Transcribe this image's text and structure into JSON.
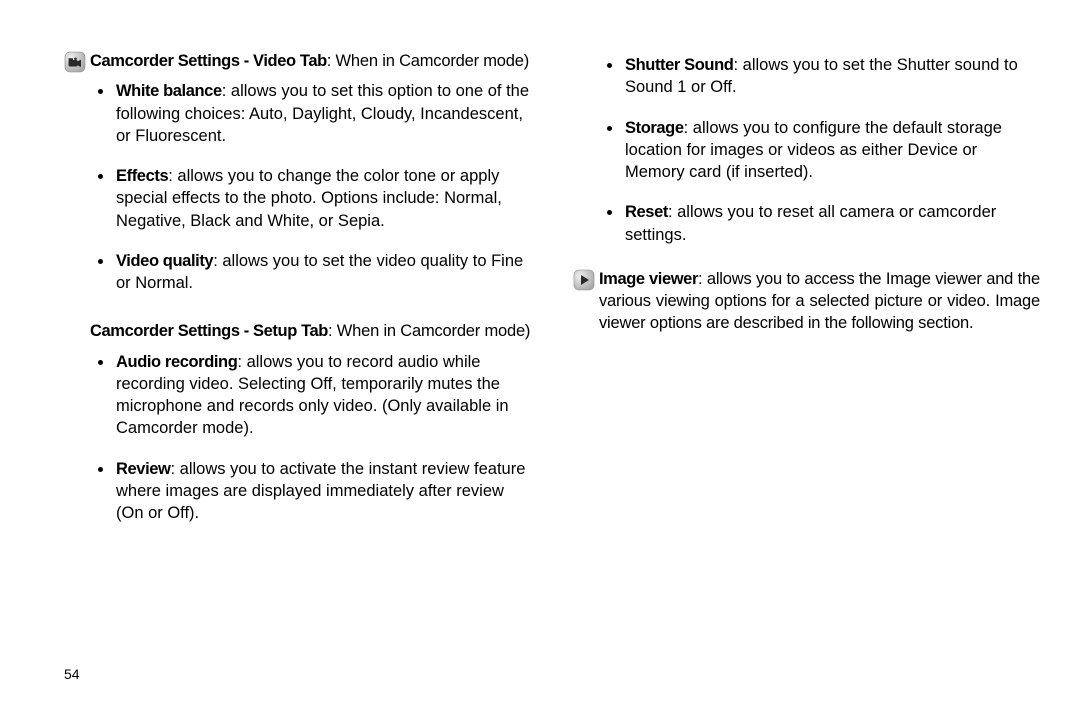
{
  "pageNumber": "54",
  "leftColumn": {
    "section1": {
      "heading": {
        "lead": "Camcorder Settings - Video Tab",
        "rest": ": When in Camcorder mode)"
      },
      "bullets": [
        {
          "lead": "White balance",
          "rest": ": allows you to set this option to one of the following choices: Auto, Daylight, Cloudy, Incandescent, or Fluorescent."
        },
        {
          "lead": "Effects",
          "rest": ": allows you to change the color tone or apply special effects to the photo. Options include: Normal, Negative, Black and White, or Sepia."
        },
        {
          "lead": "Video quality",
          "rest": ": allows you to set the video quality to Fine or Normal."
        }
      ]
    },
    "section2": {
      "heading": {
        "lead": "Camcorder Settings - Setup Tab",
        "rest": ": When in Camcorder mode)"
      },
      "bullets": [
        {
          "lead": "Audio recording",
          "rest": ": allows you to record audio while recording video. Selecting Off, temporarily mutes the microphone and records only video. (Only available in Camcorder mode)."
        },
        {
          "lead": "Review",
          "rest": ": allows you to activate the instant review feature where images are displayed immediately after review (On or Off)."
        }
      ]
    }
  },
  "rightColumn": {
    "continuedBullets": [
      {
        "lead": "Shutter Sound",
        "rest": ": allows you to set the Shutter sound to Sound 1 or Off."
      },
      {
        "lead": "Storage",
        "rest": ": allows you to configure the default storage location for images or videos as either Device or Memory card (if inserted)."
      },
      {
        "lead": "Reset",
        "rest": ": allows you to reset all camera or camcorder settings."
      }
    ],
    "imageViewer": {
      "para": {
        "lead": "Image viewer",
        "rest": ": allows you to access the Image viewer and the various viewing options for a selected picture or video. Image viewer options are described in the following section."
      }
    }
  }
}
